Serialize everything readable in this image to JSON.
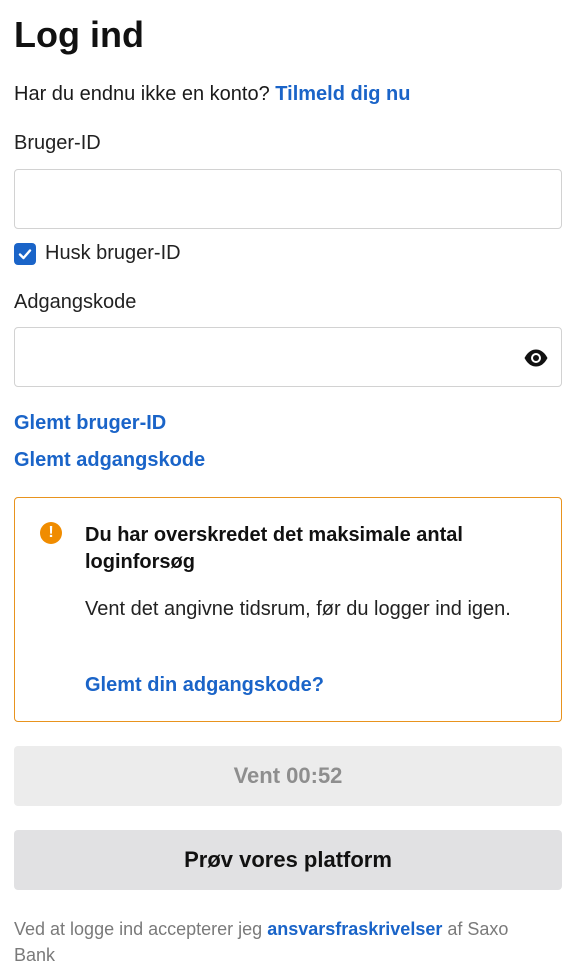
{
  "login": {
    "title": "Log ind",
    "signup_prompt": "Har du endnu ikke en konto?",
    "signup_link": "Tilmeld dig nu",
    "user_id_label": "Bruger-ID",
    "user_id_value": "",
    "remember_label": "Husk bruger-ID",
    "remember_checked": true,
    "password_label": "Adgangskode",
    "password_value": "",
    "forgot_user_id": "Glemt bruger-ID",
    "forgot_password": "Glemt adgangskode"
  },
  "alert": {
    "icon": "warning-icon",
    "title": "Du har overskredet det maksimale antal loginforsøg",
    "body": "Vent det angivne tidsrum, før du logger ind igen.",
    "link": "Glemt din adgangskode?",
    "border_color": "#e8931e",
    "icon_color": "#f08c00"
  },
  "buttons": {
    "wait_label": "Vent 00:52",
    "try_platform_label": "Prøv vores platform"
  },
  "footer": {
    "disclaimer_prefix": "Ved at logge ind accepterer jeg",
    "disclaimer_link": "ansvarsfraskrivelser",
    "disclaimer_suffix": "af Saxo Bank"
  },
  "colors": {
    "link": "#1a64c8",
    "checkbox": "#1a64c8"
  }
}
